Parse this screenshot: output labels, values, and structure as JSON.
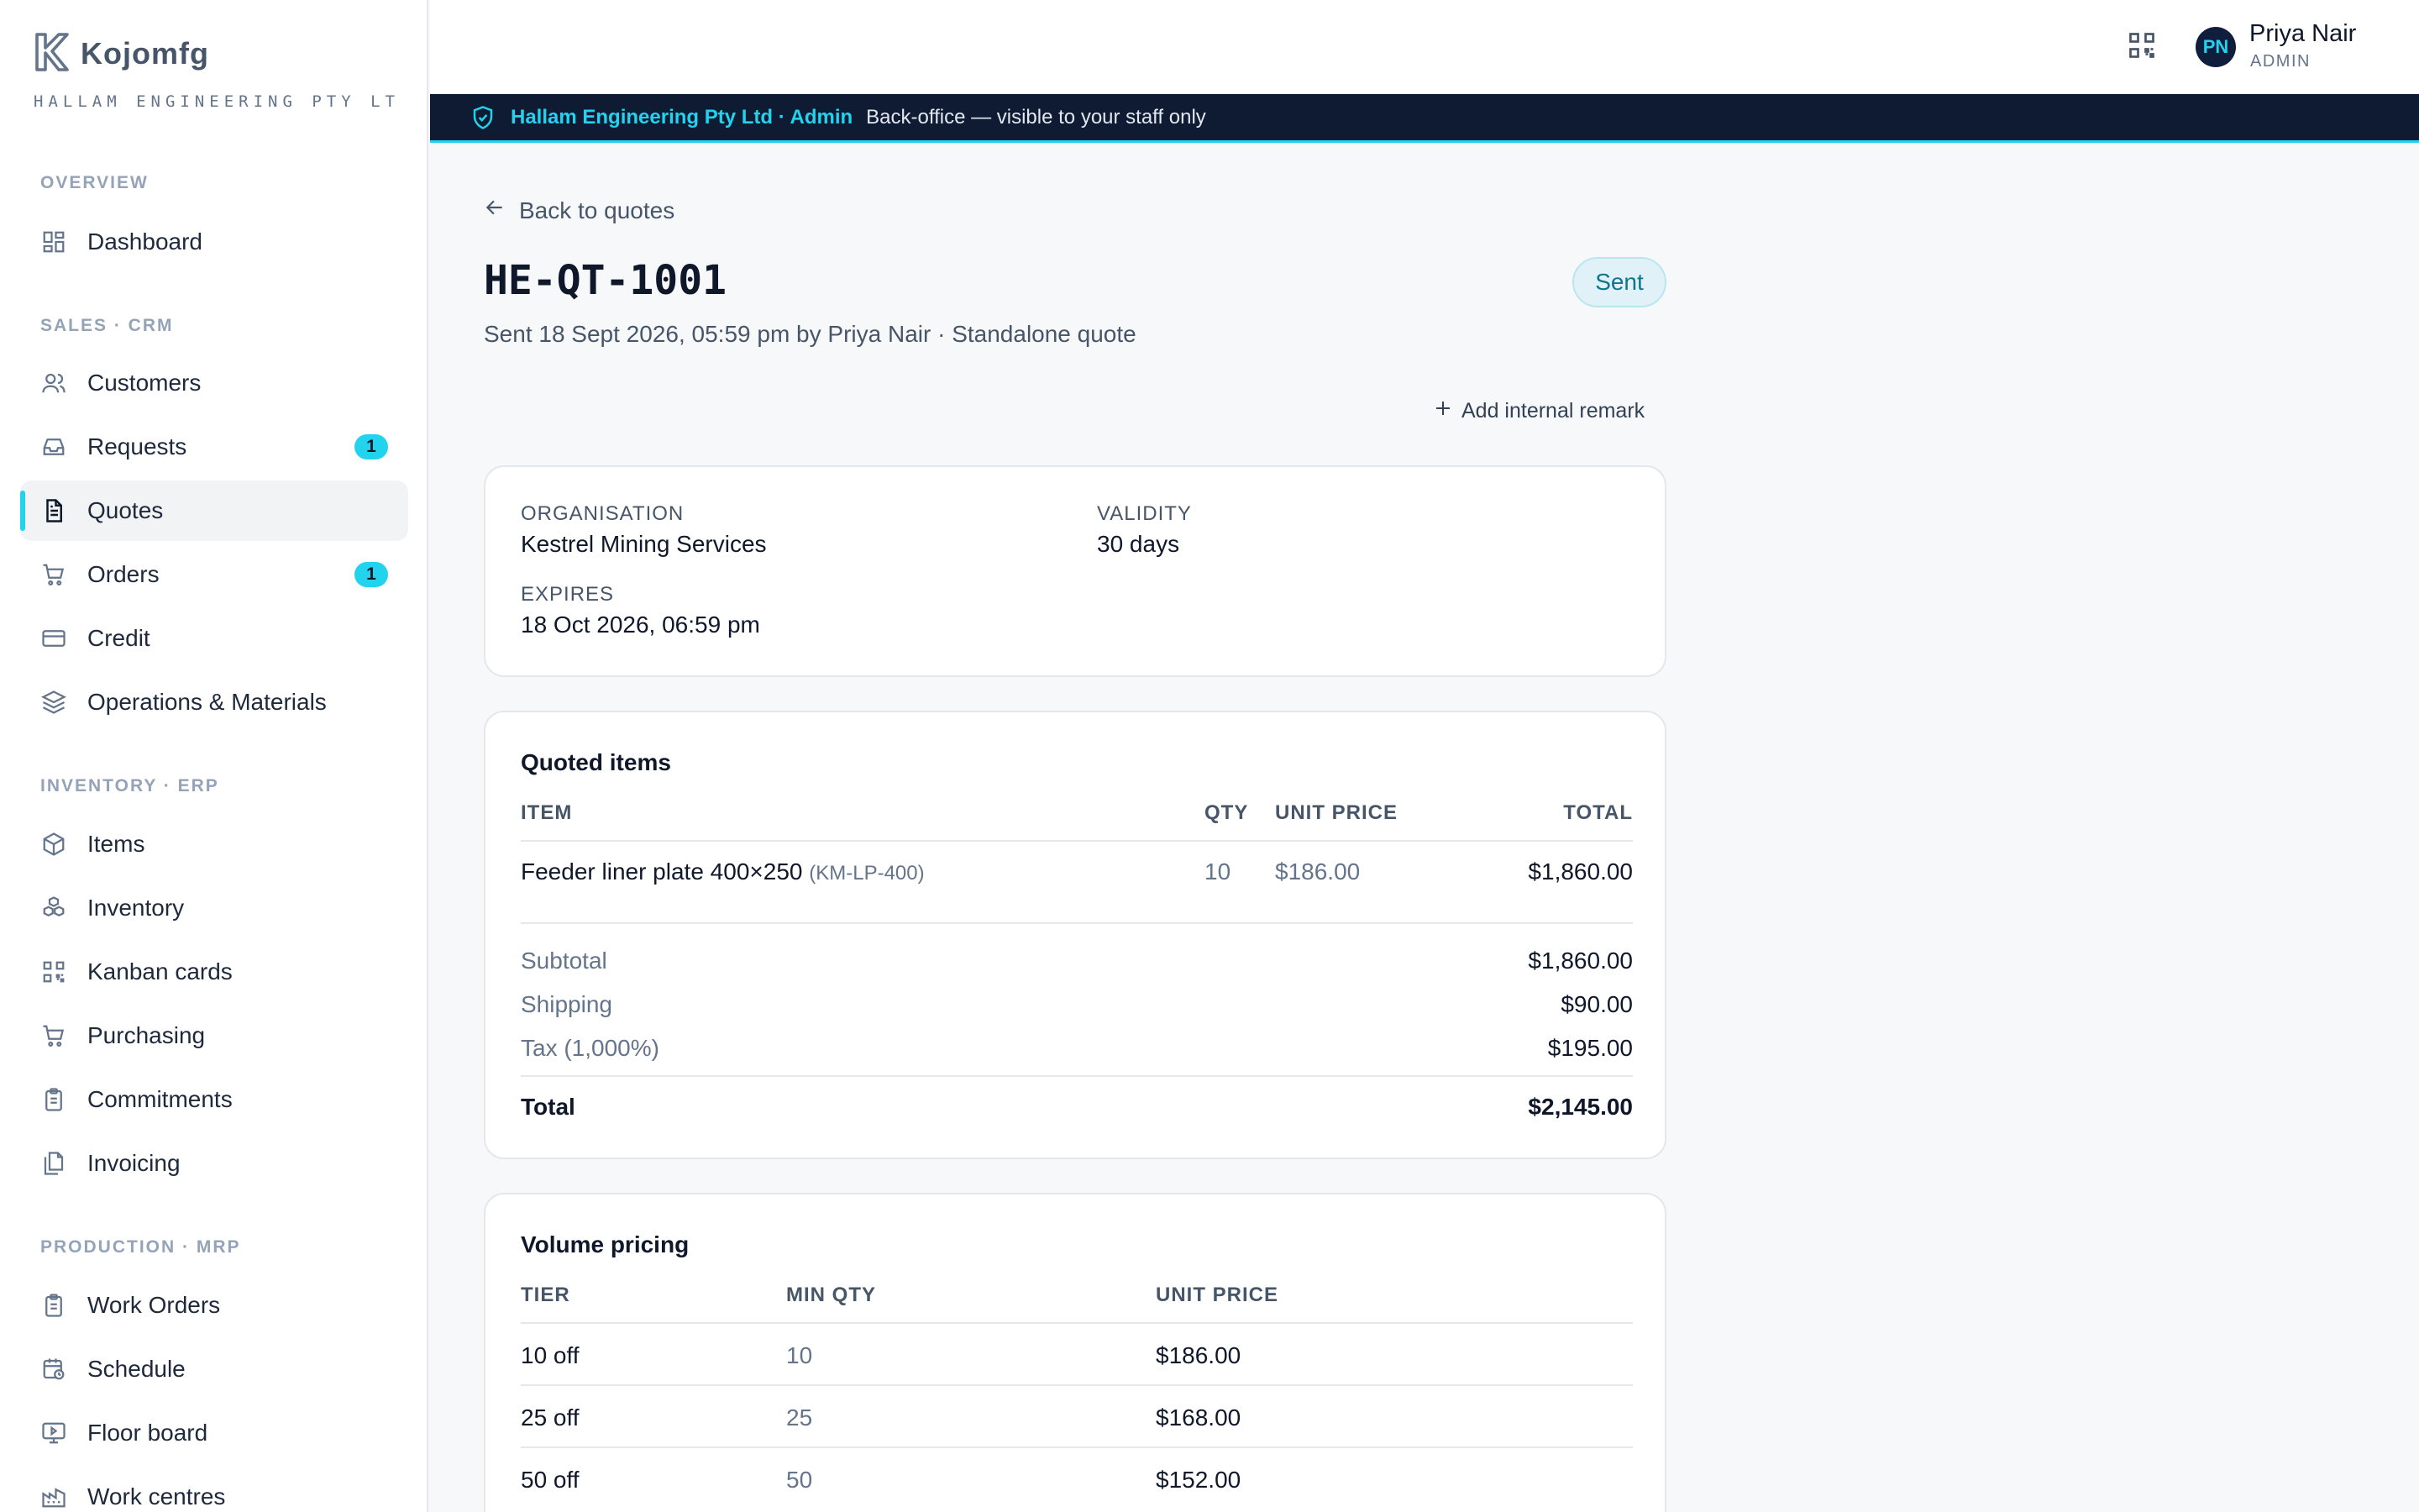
{
  "brand": {
    "name": "Kojomfg",
    "org": "HALLAM ENGINEERING PTY LTD …"
  },
  "sidebar": {
    "sections": [
      {
        "title": "OVERVIEW"
      },
      {
        "title": "SALES · CRM"
      },
      {
        "title": "INVENTORY · ERP"
      },
      {
        "title": "PRODUCTION · MRP"
      }
    ],
    "items": [
      {
        "label": "Dashboard",
        "icon": "dashboard-icon"
      },
      {
        "label": "Customers",
        "icon": "users-icon"
      },
      {
        "label": "Requests",
        "icon": "inbox-icon",
        "badge": "1"
      },
      {
        "label": "Quotes",
        "icon": "document-icon",
        "active": true
      },
      {
        "label": "Orders",
        "icon": "cart-icon",
        "badge": "1"
      },
      {
        "label": "Credit",
        "icon": "credit-card-icon"
      },
      {
        "label": "Operations & Materials",
        "icon": "layers-icon"
      },
      {
        "label": "Items",
        "icon": "package-icon"
      },
      {
        "label": "Inventory",
        "icon": "boxes-icon"
      },
      {
        "label": "Kanban cards",
        "icon": "qr-code-icon"
      },
      {
        "label": "Purchasing",
        "icon": "cart-icon"
      },
      {
        "label": "Commitments",
        "icon": "clipboard-icon"
      },
      {
        "label": "Invoicing",
        "icon": "files-icon"
      },
      {
        "label": "Work Orders",
        "icon": "clipboard-icon"
      },
      {
        "label": "Schedule",
        "icon": "calendar-clock-icon"
      },
      {
        "label": "Floor board",
        "icon": "monitor-icon"
      },
      {
        "label": "Work centres",
        "icon": "factory-icon"
      }
    ]
  },
  "user": {
    "initials": "PN",
    "name": "Priya Nair",
    "role": "ADMIN"
  },
  "banner": {
    "strong": "Hallam Engineering Pty Ltd · Admin",
    "text": "Back-office — visible to your staff only"
  },
  "quote": {
    "back": "Back to quotes",
    "number": "HE-QT-1001",
    "subtitle": "Sent 18 Sept 2026, 05:59 pm by Priya Nair · Standalone quote",
    "status": "Sent",
    "add_remark": "Add internal remark"
  },
  "details": {
    "organisation_label": "ORGANISATION",
    "organisation": "Kestrel Mining Services",
    "validity_label": "VALIDITY",
    "validity": "30 days",
    "expires_label": "EXPIRES",
    "expires": "18 Oct 2026, 06:59 pm"
  },
  "items_table": {
    "title": "Quoted items",
    "headers": {
      "item": "ITEM",
      "qty": "QTY",
      "unit_price": "UNIT PRICE",
      "total": "TOTAL"
    },
    "rows": [
      {
        "item": "Feeder liner plate 400×250",
        "sku": "(KM-LP-400)",
        "qty": "10",
        "unit_price": "$186.00",
        "total": "$1,860.00"
      }
    ],
    "summary": {
      "subtotal_label": "Subtotal",
      "subtotal": "$1,860.00",
      "shipping_label": "Shipping",
      "shipping": "$90.00",
      "tax_label": "Tax (1,000%)",
      "tax": "$195.00",
      "total_label": "Total",
      "total": "$2,145.00"
    }
  },
  "volume_pricing": {
    "title": "Volume pricing",
    "headers": {
      "tier": "TIER",
      "min_qty": "MIN QTY",
      "unit_price": "UNIT PRICE"
    },
    "rows": [
      {
        "tier": "10 off",
        "min_qty": "10",
        "unit_price": "$186.00"
      },
      {
        "tier": "25 off",
        "min_qty": "25",
        "unit_price": "$168.00"
      },
      {
        "tier": "50 off",
        "min_qty": "50",
        "unit_price": "$152.00"
      }
    ]
  },
  "colors": {
    "accent": "#22d3ee",
    "banner_bg": "#0f1a33",
    "status_text": "#0e7490"
  }
}
